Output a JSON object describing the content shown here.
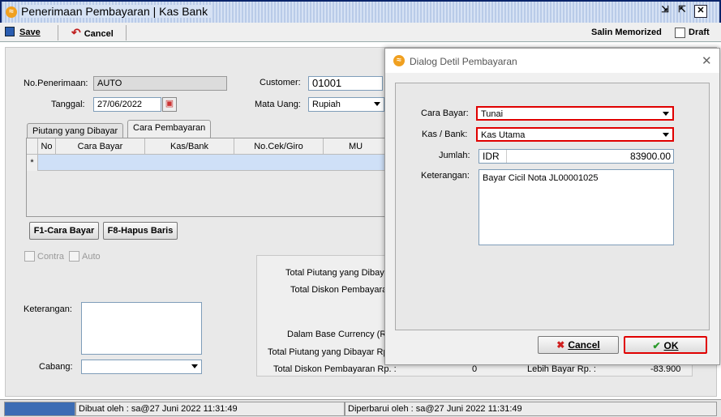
{
  "window": {
    "title": "Penerimaan Pembayaran | Kas Bank",
    "icon": "app-logo-icon"
  },
  "toolbar": {
    "save": "Save",
    "cancel": "Cancel",
    "salin": "Salin Memorized",
    "draft": "Draft"
  },
  "form": {
    "no_label": "No.Penerimaan:",
    "no_value": "AUTO",
    "tanggal_label": "Tanggal:",
    "tanggal_value": "27/06/2022",
    "customer_label": "Customer:",
    "customer_value": "01001",
    "matauang_label": "Mata Uang:",
    "matauang_value": "Rupiah"
  },
  "tabs": [
    "Piutang yang Dibayar",
    "Cara Pembayaran"
  ],
  "grid": {
    "columns": [
      "No",
      "Cara Bayar",
      "Kas/Bank",
      "No.Cek/Giro",
      "MU"
    ],
    "new_row": "*"
  },
  "buttons": {
    "f1": "F1-Cara Bayar",
    "f8": "F8-Hapus Baris"
  },
  "checks": {
    "contra": "Contra",
    "auto": "Auto"
  },
  "bottom": {
    "keterangan": "Keterangan:",
    "cabang": "Cabang:"
  },
  "totals": {
    "t1": "Total Piutang yang Dibaya",
    "t2": "Total Diskon Pembayara",
    "base": "Dalam Base Currency (Rp",
    "t3": "Total Piutang yang Dibayar Rp",
    "t4": "Total Diskon Pembayaran Rp. :",
    "t4_val": "0",
    "lebih": "Lebih Bayar Rp. :",
    "lebih_val": "-83.900"
  },
  "dialog": {
    "title": "Dialog Detil Pembayaran",
    "cara_label": "Cara Bayar:",
    "cara_value": "Tunai",
    "kas_label": "Kas / Bank:",
    "kas_value": "Kas Utama",
    "jumlah_label": "Jumlah:",
    "currency": "IDR",
    "jumlah_value": "83900.00",
    "ket_label": "Keterangan:",
    "ket_value": "Bayar Cicil Nota JL00001025",
    "cancel": "Cancel",
    "ok": "OK"
  },
  "status": {
    "dibuat": "Dibuat oleh : sa@27 Juni 2022  11:31:49",
    "diperbarui": "Diperbarui oleh : sa@27 Juni 2022  11:31:49"
  }
}
